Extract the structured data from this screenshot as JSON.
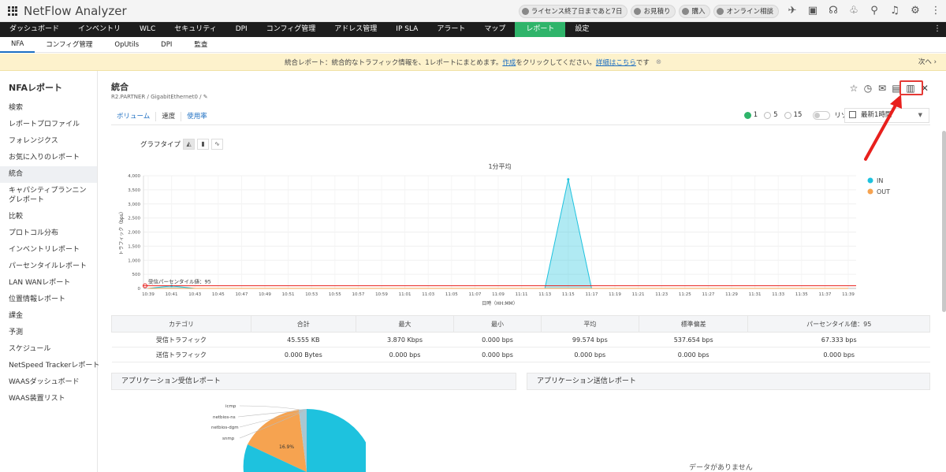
{
  "app": {
    "title": "NetFlow Analyzer"
  },
  "header": {
    "pills": [
      "ライセンス終了日まであと7日",
      "お見積り",
      "購入",
      "オンライン相談"
    ],
    "icons": [
      "rocket-icon",
      "monitor-icon",
      "headset-icon",
      "gift-icon",
      "search-icon",
      "bell-icon",
      "gear-icon",
      "more-icon"
    ]
  },
  "nav": {
    "items": [
      "ダッシュボード",
      "インベントリ",
      "WLC",
      "セキュリティ",
      "DPI",
      "コンフィグ管理",
      "アドレス管理",
      "IP SLA",
      "アラート",
      "マップ",
      "レポート",
      "設定"
    ],
    "active": "レポート"
  },
  "subnav": {
    "items": [
      "NFA",
      "コンフィグ管理",
      "OpUtils",
      "DPI",
      "監査"
    ]
  },
  "banner": {
    "prefix": "統合レポート：統合的なトラフィック情報を、1レポートにまとめます。",
    "link1": "作成",
    "middle": "をクリックしてください。",
    "link2": "詳細はこちら",
    "suffix": "です",
    "next": "次へ"
  },
  "sidebar": {
    "title": "NFAレポート",
    "items": [
      "検索",
      "レポートプロファイル",
      "フォレンジクス",
      "お気に入りのレポート",
      "統合",
      "キャパシティプランニングレポート",
      "比較",
      "プロトコル分布",
      "インベントリレポート",
      "パーセンタイルレポート",
      "LAN WANレポート",
      "位置情報レポート",
      "課金",
      "予測",
      "スケジュール",
      "NetSpeed Trackerレポート",
      "WAASダッシュボード",
      "WAAS装置リスト"
    ],
    "active_index": 4
  },
  "main": {
    "title": "統合",
    "breadcrumb": "R2.PARTNER  /  GigabitEthernet0  /",
    "tabs": [
      "ボリューム",
      "速度",
      "使用率"
    ],
    "current_tab": "速度",
    "intervals": [
      "1",
      "5",
      "15"
    ],
    "selected_interval": "1",
    "resolve_ip_label": "リゾルブIP",
    "time_range": "最新1時間",
    "graph_type_label": "グラフタイプ"
  },
  "chart_data": {
    "type": "area",
    "title": "1分平均",
    "xlabel": "日時（HH:MM）",
    "ylabel": "トラフィック（bps）",
    "ylim": [
      0,
      4000
    ],
    "yticks": [
      "0",
      "500",
      "1,000",
      "1,500",
      "2,000",
      "2,500",
      "3,000",
      "3,500",
      "4,000"
    ],
    "categories": [
      "10:39",
      "10:41",
      "10:43",
      "10:45",
      "10:47",
      "10:49",
      "10:51",
      "10:53",
      "10:55",
      "10:57",
      "10:59",
      "11:01",
      "11:03",
      "11:05",
      "11:07",
      "11:09",
      "11:11",
      "11:13",
      "11:15",
      "11:17",
      "11:19",
      "11:21",
      "11:23",
      "11:25",
      "11:27",
      "11:29",
      "11:31",
      "11:33",
      "11:35",
      "11:37",
      "11:39"
    ],
    "series": [
      {
        "name": "IN",
        "color": "#1ec2de",
        "values": [
          0,
          90,
          0,
          0,
          0,
          0,
          0,
          0,
          0,
          0,
          0,
          0,
          0,
          0,
          0,
          0,
          0,
          0,
          3870,
          0,
          0,
          0,
          0,
          0,
          0,
          0,
          0,
          0,
          0,
          0,
          0
        ]
      },
      {
        "name": "OUT",
        "color": "#f6a350",
        "values": [
          0,
          0,
          0,
          0,
          0,
          0,
          0,
          0,
          0,
          0,
          0,
          0,
          0,
          0,
          0,
          0,
          0,
          0,
          0,
          0,
          0,
          0,
          0,
          0,
          0,
          0,
          0,
          0,
          0,
          0,
          0
        ]
      }
    ],
    "percentile_label": "受信パーセンタイル値：95",
    "percentile_value": 95
  },
  "stats": {
    "headers": [
      "カテゴリ",
      "合計",
      "最大",
      "最小",
      "平均",
      "標準偏差",
      "パーセンタイル値：95"
    ],
    "rows": [
      [
        "受信トラフィック",
        "45.555 KB",
        "3.870 Kbps",
        "0.000 bps",
        "99.574 bps",
        "537.654 bps",
        "67.333 bps"
      ],
      [
        "送信トラフィック",
        "0.000 Bytes",
        "0.000 bps",
        "0.000 bps",
        "0.000 bps",
        "0.000 bps",
        "0.000 bps"
      ]
    ]
  },
  "panels": {
    "recv_title": "アプリケーション受信レポート",
    "send_title": "アプリケーション送信レポート",
    "no_data": "データがありません"
  },
  "pie_data": {
    "type": "pie",
    "labels": [
      "icmp",
      "netbios-ns",
      "netbios-dgm",
      "snmp"
    ],
    "main_label": "16.9%",
    "colors": {
      "main": "#1ec2de",
      "secondary": "#f6a350"
    }
  }
}
